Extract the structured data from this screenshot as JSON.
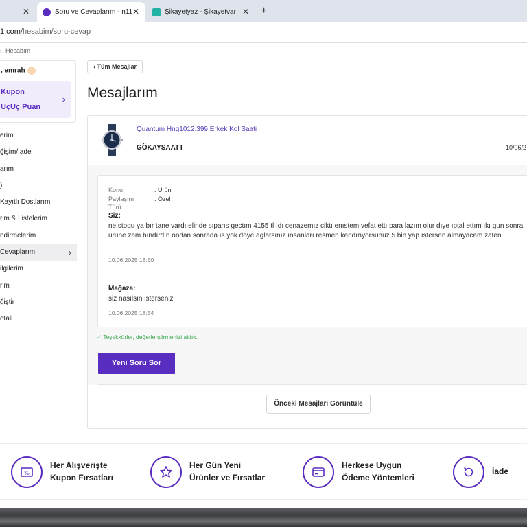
{
  "browser": {
    "tabs": [
      {
        "label": "Soru ve Cevaplarım - n11",
        "active": true
      },
      {
        "label": "Şikayetyaz - Şikayetvar",
        "active": false
      }
    ],
    "url_host": "1.com",
    "url_path": "/hesabim/soru-cevap"
  },
  "sidebar": {
    "breadcrumb": "Hesabım",
    "greeting": ", emrah",
    "promo_line1": "Kupon",
    "promo_line2": "UçUç Puan",
    "items": [
      {
        "label": "erim"
      },
      {
        "label": "ğişim/İade"
      },
      {
        "label": "arım"
      },
      {
        "label": ")"
      },
      {
        "label": " Kayıtlı Dostlarım"
      },
      {
        "label": "rim & Listelerim"
      },
      {
        "label": "ndirmelerim"
      },
      {
        "label": " Cevaplarım",
        "active": true
      },
      {
        "label": "ilgilerim"
      },
      {
        "label": "rim"
      },
      {
        "label": "ğiştir"
      },
      {
        "label": "otali"
      }
    ]
  },
  "main": {
    "back_label": "Tüm Mesajlar",
    "title": "Mesajlarım",
    "product_name": "Quantum Hng1012.399 Erkek Kol Saati",
    "seller": "GÖKAYSAATT",
    "date": "10/06/2",
    "message": {
      "konu_label": "Konu",
      "konu_value": ": Ürün",
      "paylasim_label": "Paylaşım",
      "paylasim_value": ": Özel",
      "turu_label": "Türü",
      "sender": "Siz:",
      "text": "ne stogu ya bır tane vardı elinde sıparıs gectım 4155 tl ıdı cenazemız ciktı enıstem vefat ettı para lazım olur dıye ıptal ettım ıkı gun sonra urune zam bındırdın ondan sonrada ıs yok doye aglarsınız ınsanları resmen kandırıyorsunuz 5 bin yap ıstersen almayacam zaten",
      "timestamp": "10.06.2025 18:50"
    },
    "reply": {
      "sender": "Mağaza:",
      "text": "siz nasılsın isterseniz",
      "timestamp": "10.06.2025 18:54"
    },
    "thanks": "✓ Teşekkürler, değerlendirmenizi aldık.",
    "ask_button": "Yeni Soru Sor",
    "prev_button": "Önceki Mesajları Görüntüle"
  },
  "features": [
    {
      "icon": "coupon-icon",
      "line1": "Her Alışverişte",
      "line2": "Kupon Fırsatları"
    },
    {
      "icon": "star-icon",
      "line1": "Her Gün Yeni",
      "line2": "Ürünler ve Fırsatlar"
    },
    {
      "icon": "card-icon",
      "line1": "Herkese Uygun",
      "line2": "Ödeme Yöntemleri"
    },
    {
      "icon": "return-icon",
      "line1": "İade",
      "line2": ""
    }
  ],
  "colors": {
    "accent": "#5a2dc1",
    "link": "#5a3fb5",
    "success": "#3aa84e"
  }
}
